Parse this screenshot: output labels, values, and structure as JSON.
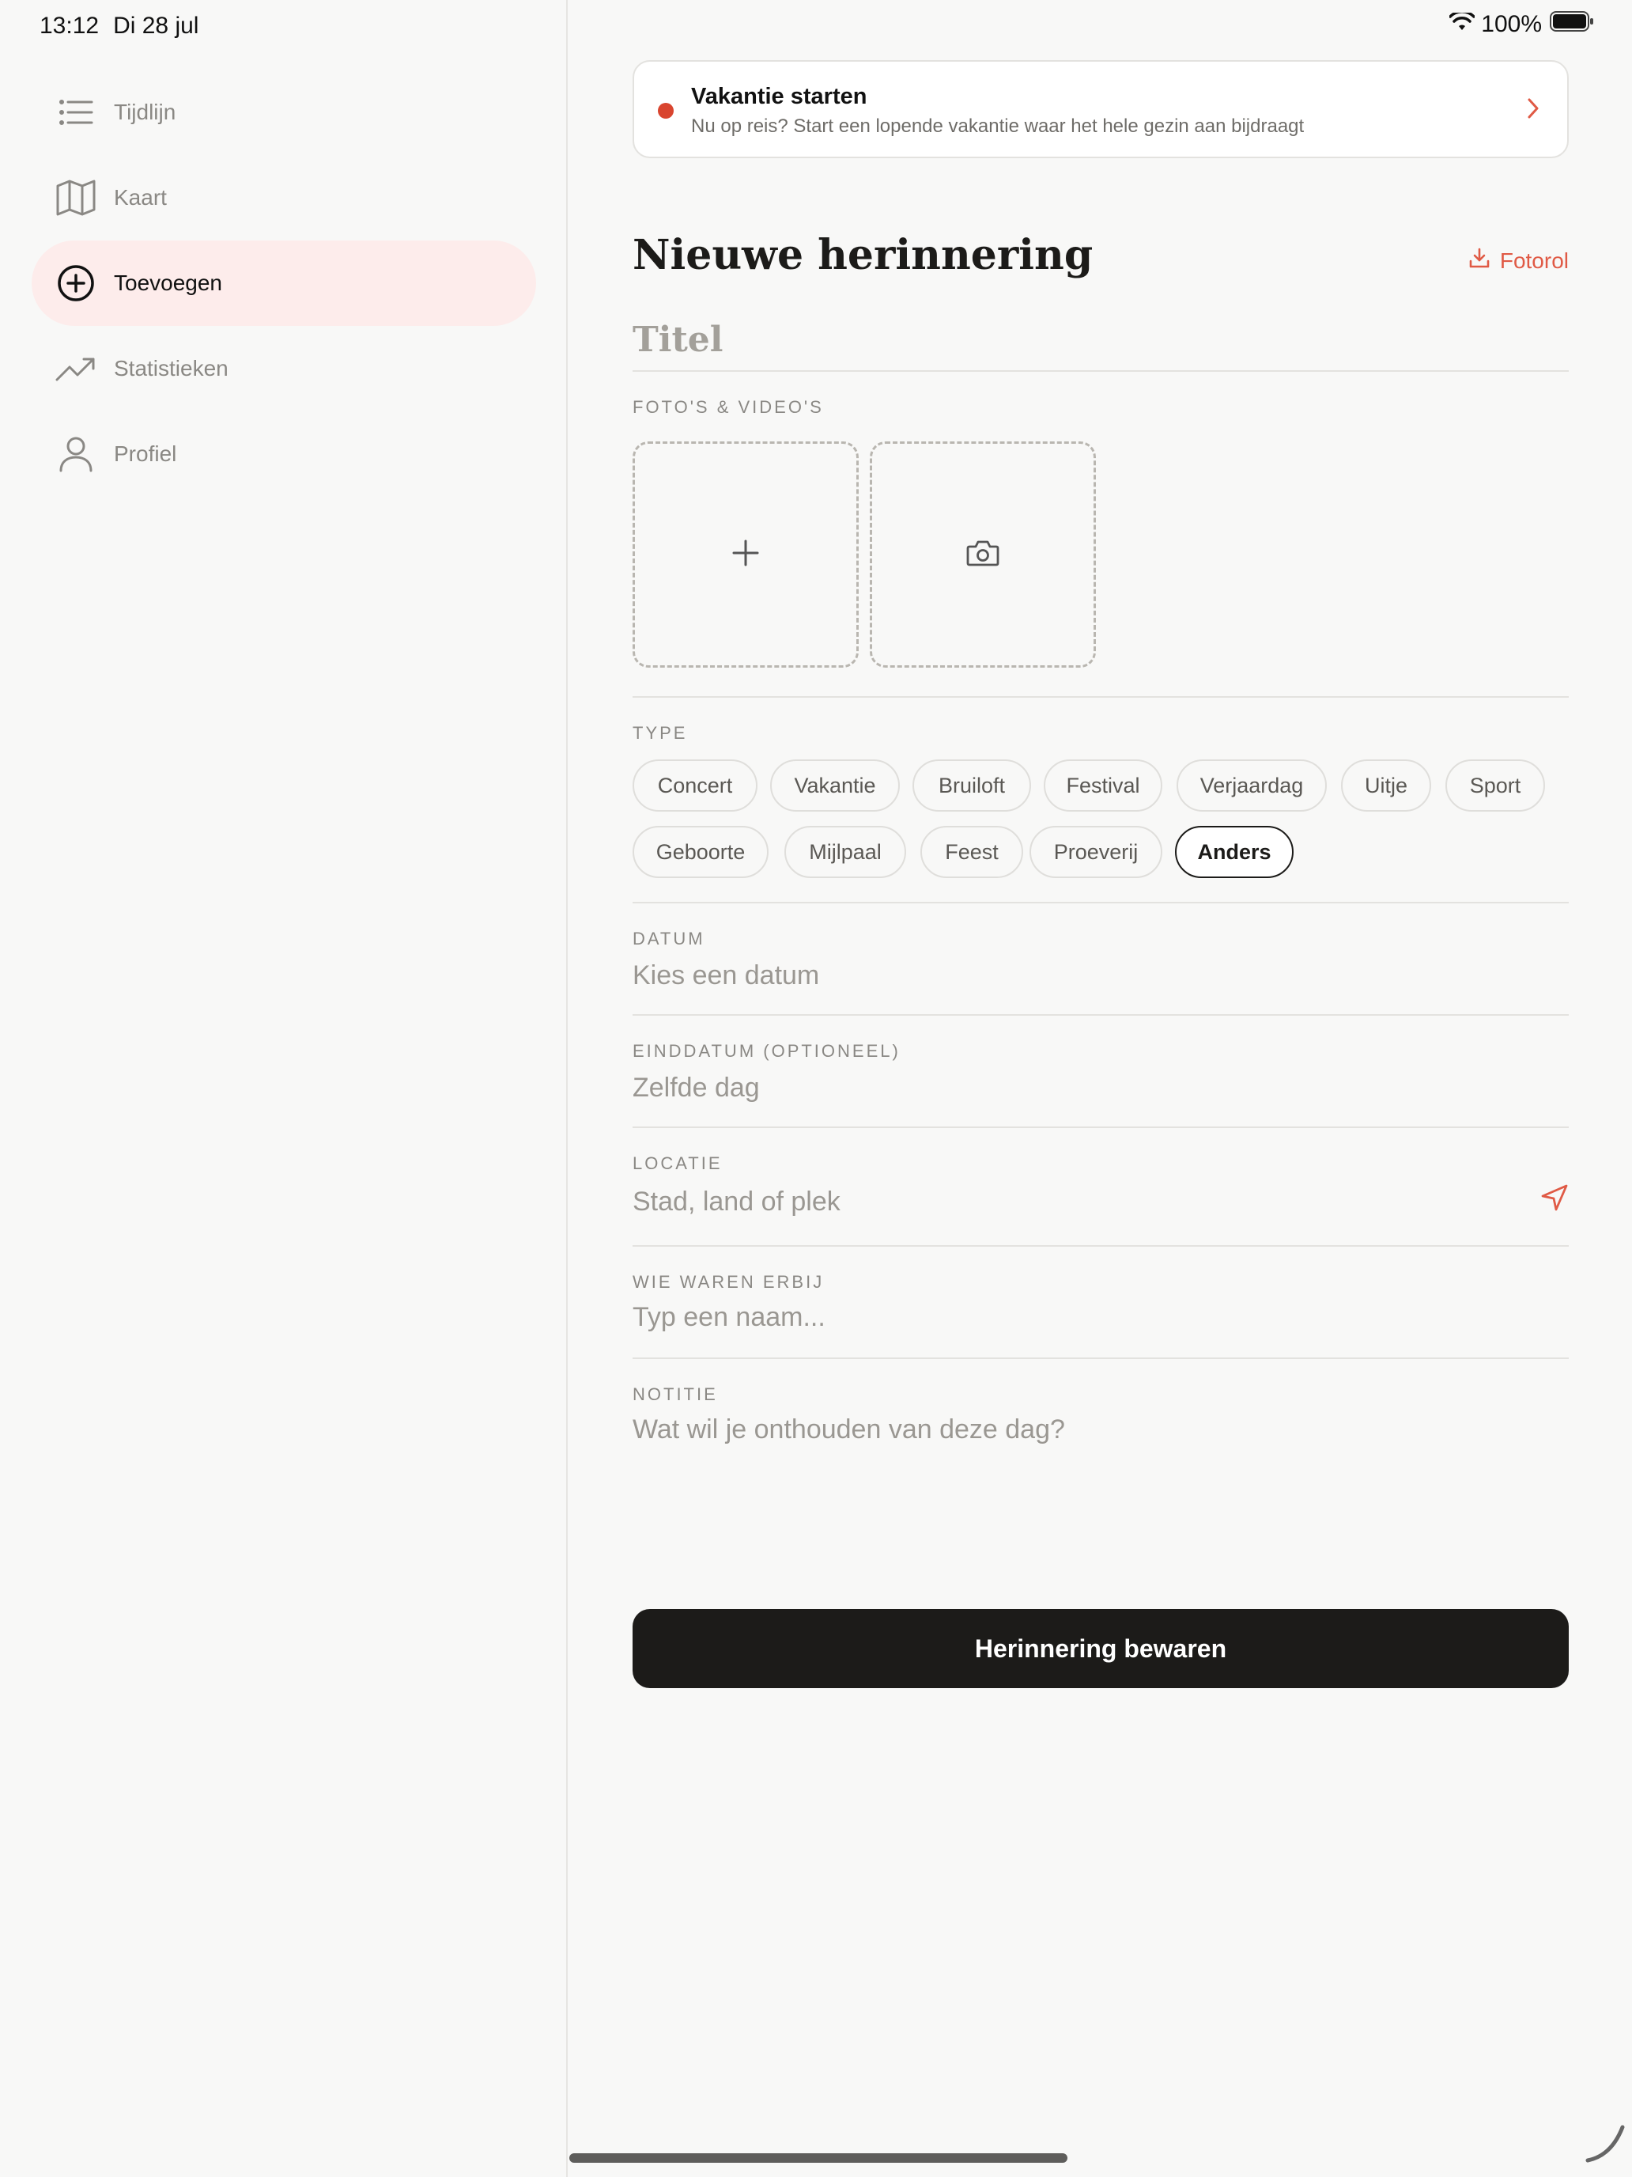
{
  "status_bar": {
    "time": "13:12",
    "date": "Di 28 jul",
    "battery": "100%"
  },
  "sidebar": {
    "items": [
      {
        "label": "Tijdlijn",
        "icon": "list-icon"
      },
      {
        "label": "Kaart",
        "icon": "map-icon"
      },
      {
        "label": "Toevoegen",
        "icon": "plus-circle-icon",
        "active": true
      },
      {
        "label": "Statistieken",
        "icon": "trend-up-icon"
      },
      {
        "label": "Profiel",
        "icon": "person-icon"
      }
    ]
  },
  "banner": {
    "title": "Vakantie starten",
    "subtitle": "Nu op reis? Start een lopende vakantie waar het hele gezin aan bijdraagt"
  },
  "header": {
    "title": "Nieuwe herinnering",
    "fotorol": "Fotorol"
  },
  "form": {
    "title_placeholder": "Titel",
    "media_label": "FOTO'S & VIDEO'S",
    "type_label": "TYPE",
    "types": [
      "Concert",
      "Vakantie",
      "Bruiloft",
      "Festival",
      "Verjaardag",
      "Uitje",
      "Sport",
      "Geboorte",
      "Mijlpaal",
      "Feest",
      "Proeverij",
      "Anders"
    ],
    "selected_type": "Anders",
    "datum_label": "DATUM",
    "datum_placeholder": "Kies een datum",
    "einddatum_label": "EINDDATUM (OPTIONEEL)",
    "einddatum_placeholder": "Zelfde dag",
    "locatie_label": "LOCATIE",
    "locatie_placeholder": "Stad, land of plek",
    "wie_label": "WIE WAREN ERBIJ",
    "wie_placeholder": "Typ een naam...",
    "notitie_label": "NOTITIE",
    "notitie_placeholder": "Wat wil je onthouden van deze dag?",
    "save_label": "Herinnering bewaren"
  },
  "colors": {
    "accent": "#e05a45",
    "dark": "#1c1b19",
    "active_nav_bg": "#fdeceb"
  }
}
